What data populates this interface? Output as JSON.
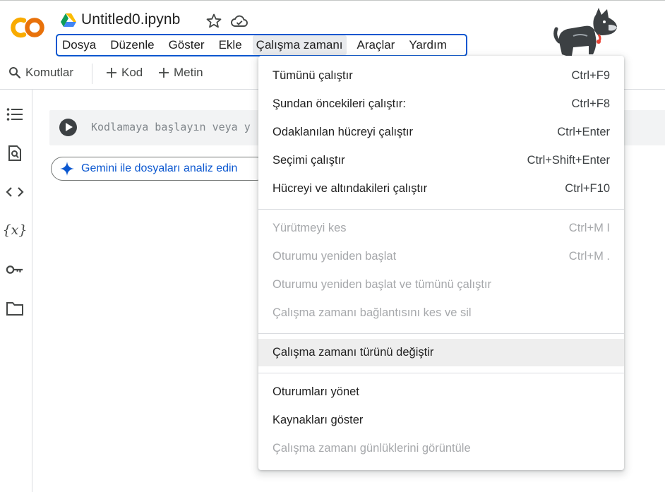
{
  "header": {
    "doc_title": "Untitled0.ipynb",
    "menu": [
      "Dosya",
      "Düzenle",
      "Göster",
      "Ekle",
      "Çalışma zamanı",
      "Araçlar",
      "Yardım"
    ],
    "active_menu": "Çalışma zamanı"
  },
  "toolbar": {
    "commands_label": "Komutlar",
    "code_label": "Kod",
    "text_label": "Metin"
  },
  "rail": {
    "icons": [
      "list-icon",
      "search-doc-icon",
      "code-icon",
      "variables-icon",
      "key-icon",
      "folder-icon"
    ],
    "variables_glyph": "{x}"
  },
  "cell": {
    "placeholder": "Kodlamaya başlayın veya y"
  },
  "gemini": {
    "label": "Gemini ile dosyaları analiz edin"
  },
  "runtime_menu": {
    "groups": [
      [
        {
          "label": "Tümünü çalıştır",
          "shortcut": "Ctrl+F9",
          "enabled": true
        },
        {
          "label": "Şundan öncekileri çalıştır:",
          "shortcut": "Ctrl+F8",
          "enabled": true
        },
        {
          "label": "Odaklanılan hücreyi çalıştır",
          "shortcut": "Ctrl+Enter",
          "enabled": true
        },
        {
          "label": "Seçimi çalıştır",
          "shortcut": "Ctrl+Shift+Enter",
          "enabled": true
        },
        {
          "label": "Hücreyi ve altındakileri çalıştır",
          "shortcut": "Ctrl+F10",
          "enabled": true
        }
      ],
      [
        {
          "label": "Yürütmeyi kes",
          "shortcut": "Ctrl+M I",
          "enabled": false
        },
        {
          "label": "Oturumu yeniden başlat",
          "shortcut": "Ctrl+M .",
          "enabled": false
        },
        {
          "label": "Oturumu yeniden başlat ve tümünü çalıştır",
          "shortcut": "",
          "enabled": false
        },
        {
          "label": "Çalışma zamanı bağlantısını kes ve sil",
          "shortcut": "",
          "enabled": false
        }
      ],
      [
        {
          "label": "Çalışma zamanı türünü değiştir",
          "shortcut": "",
          "enabled": true,
          "hovered": true
        }
      ],
      [
        {
          "label": "Oturumları yönet",
          "shortcut": "",
          "enabled": true
        },
        {
          "label": "Kaynakları göster",
          "shortcut": "",
          "enabled": true
        },
        {
          "label": "Çalışma zamanı günlüklerini görüntüle",
          "shortcut": "",
          "enabled": false
        }
      ]
    ]
  },
  "colors": {
    "accent_blue": "#0b57d0",
    "logo_orange": "#f9ab00",
    "logo_dark_orange": "#e8710a",
    "disabled_text": "#a6a8ab",
    "hover_bg": "#eeeeee"
  }
}
